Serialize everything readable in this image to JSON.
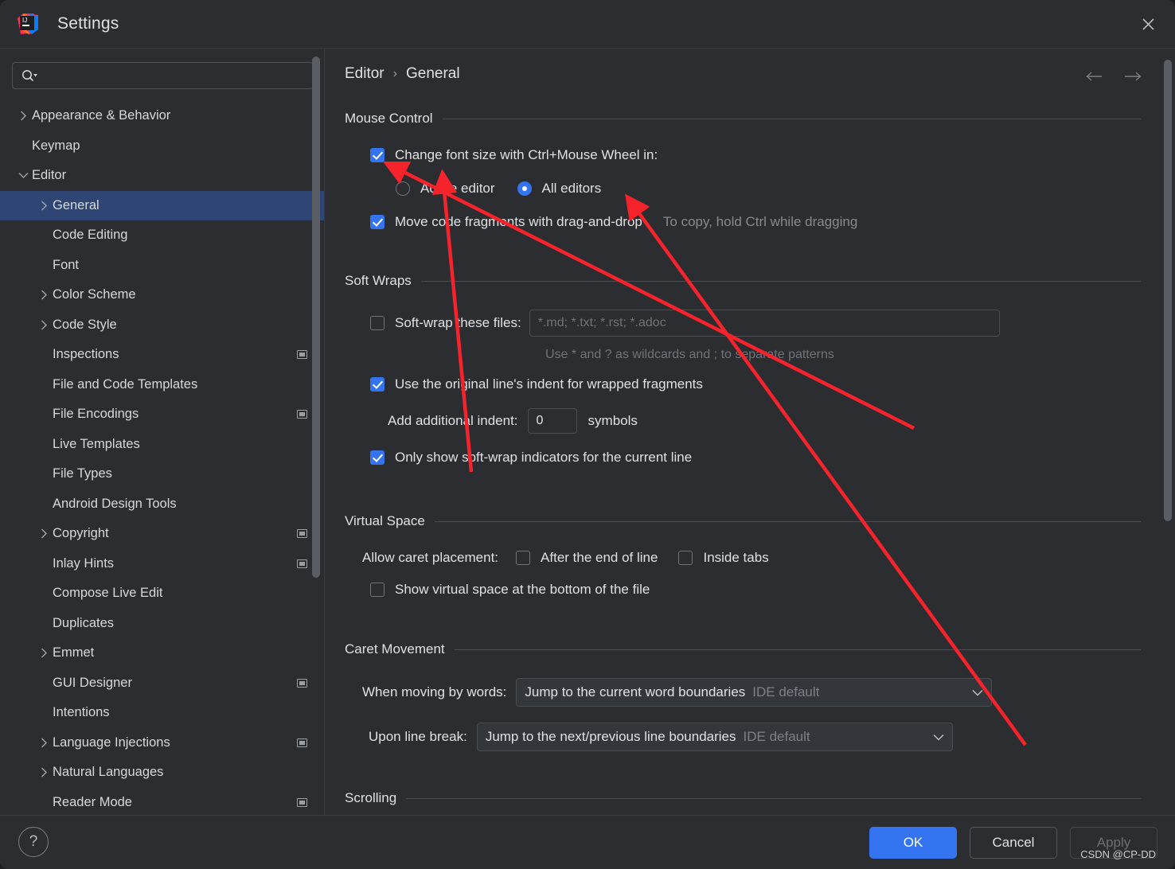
{
  "window": {
    "title": "Settings",
    "logo_icon": "intellij-idea-logo",
    "close_icon": "close-icon"
  },
  "sidebar": {
    "search": {
      "value": "",
      "placeholder": "",
      "icon": "search-icon"
    },
    "items": [
      {
        "label": "Appearance & Behavior",
        "indent": 0,
        "twisty": "collapsed",
        "badge": false,
        "selected": false
      },
      {
        "label": "Keymap",
        "indent": 0,
        "twisty": "none",
        "badge": false,
        "selected": false
      },
      {
        "label": "Editor",
        "indent": 0,
        "twisty": "expanded",
        "badge": false,
        "selected": false
      },
      {
        "label": "General",
        "indent": 1,
        "twisty": "collapsed",
        "badge": false,
        "selected": true
      },
      {
        "label": "Code Editing",
        "indent": 1,
        "twisty": "none",
        "badge": false,
        "selected": false
      },
      {
        "label": "Font",
        "indent": 1,
        "twisty": "none",
        "badge": false,
        "selected": false
      },
      {
        "label": "Color Scheme",
        "indent": 1,
        "twisty": "collapsed",
        "badge": false,
        "selected": false
      },
      {
        "label": "Code Style",
        "indent": 1,
        "twisty": "collapsed",
        "badge": false,
        "selected": false
      },
      {
        "label": "Inspections",
        "indent": 1,
        "twisty": "none",
        "badge": true,
        "selected": false
      },
      {
        "label": "File and Code Templates",
        "indent": 1,
        "twisty": "none",
        "badge": false,
        "selected": false
      },
      {
        "label": "File Encodings",
        "indent": 1,
        "twisty": "none",
        "badge": true,
        "selected": false
      },
      {
        "label": "Live Templates",
        "indent": 1,
        "twisty": "none",
        "badge": false,
        "selected": false
      },
      {
        "label": "File Types",
        "indent": 1,
        "twisty": "none",
        "badge": false,
        "selected": false
      },
      {
        "label": "Android Design Tools",
        "indent": 1,
        "twisty": "none",
        "badge": false,
        "selected": false
      },
      {
        "label": "Copyright",
        "indent": 1,
        "twisty": "collapsed",
        "badge": true,
        "selected": false
      },
      {
        "label": "Inlay Hints",
        "indent": 1,
        "twisty": "none",
        "badge": true,
        "selected": false
      },
      {
        "label": "Compose Live Edit",
        "indent": 1,
        "twisty": "none",
        "badge": false,
        "selected": false
      },
      {
        "label": "Duplicates",
        "indent": 1,
        "twisty": "none",
        "badge": false,
        "selected": false
      },
      {
        "label": "Emmet",
        "indent": 1,
        "twisty": "collapsed",
        "badge": false,
        "selected": false
      },
      {
        "label": "GUI Designer",
        "indent": 1,
        "twisty": "none",
        "badge": true,
        "selected": false
      },
      {
        "label": "Intentions",
        "indent": 1,
        "twisty": "none",
        "badge": false,
        "selected": false
      },
      {
        "label": "Language Injections",
        "indent": 1,
        "twisty": "collapsed",
        "badge": true,
        "selected": false
      },
      {
        "label": "Natural Languages",
        "indent": 1,
        "twisty": "collapsed",
        "badge": false,
        "selected": false
      },
      {
        "label": "Reader Mode",
        "indent": 1,
        "twisty": "none",
        "badge": true,
        "selected": false
      }
    ]
  },
  "main": {
    "breadcrumb": {
      "parent": "Editor",
      "separator": "›",
      "current": "General"
    },
    "nav": {
      "back_icon": "arrow-left-icon",
      "forward_icon": "arrow-right-icon"
    },
    "sections": {
      "mouse_control": {
        "title": "Mouse Control",
        "change_font_size": {
          "label": "Change font size with Ctrl+Mouse Wheel in:",
          "checked": true
        },
        "scope_radio": {
          "active_editor": {
            "label": "Active editor",
            "selected": false
          },
          "all_editors": {
            "label": "All editors",
            "selected": true
          }
        },
        "move_fragments": {
          "label": "Move code fragments with drag-and-drop",
          "checked": true,
          "hint": "To copy, hold Ctrl while dragging"
        }
      },
      "soft_wraps": {
        "title": "Soft Wraps",
        "soft_wrap_files": {
          "label": "Soft-wrap these files:",
          "checked": false,
          "value": "*.md; *.txt; *.rst; *.adoc"
        },
        "wildcard_hint": "Use * and ? as wildcards and ; to separate patterns",
        "original_indent": {
          "label": "Use the original line's indent for wrapped fragments",
          "checked": true
        },
        "additional_indent": {
          "label": "Add additional indent:",
          "value": "0",
          "unit": "symbols"
        },
        "indicators_current_line": {
          "label": "Only show soft-wrap indicators for the current line",
          "checked": true
        }
      },
      "virtual_space": {
        "title": "Virtual Space",
        "allow_caret_label": "Allow caret placement:",
        "after_end_of_line": {
          "label": "After the end of line",
          "checked": false
        },
        "inside_tabs": {
          "label": "Inside tabs",
          "checked": false
        },
        "show_virtual_space": {
          "label": "Show virtual space at the bottom of the file",
          "checked": false
        }
      },
      "caret_movement": {
        "title": "Caret Movement",
        "when_moving_by_words": {
          "label": "When moving by words:",
          "value": "Jump to the current word boundaries",
          "suffix": "IDE default"
        },
        "upon_line_break": {
          "label": "Upon line break:",
          "value": "Jump to the next/previous line boundaries",
          "suffix": "IDE default"
        }
      },
      "scrolling": {
        "title": "Scrolling"
      }
    }
  },
  "footer": {
    "help_label": "?",
    "ok_label": "OK",
    "cancel_label": "Cancel",
    "apply_label": "Apply",
    "watermark": "CSDN @CP-DD"
  },
  "colors": {
    "accent": "#3574f0",
    "selection": "#2f4675",
    "annotation": "#f5232c",
    "background": "#2b2d30",
    "text": "#dfe1e5"
  }
}
